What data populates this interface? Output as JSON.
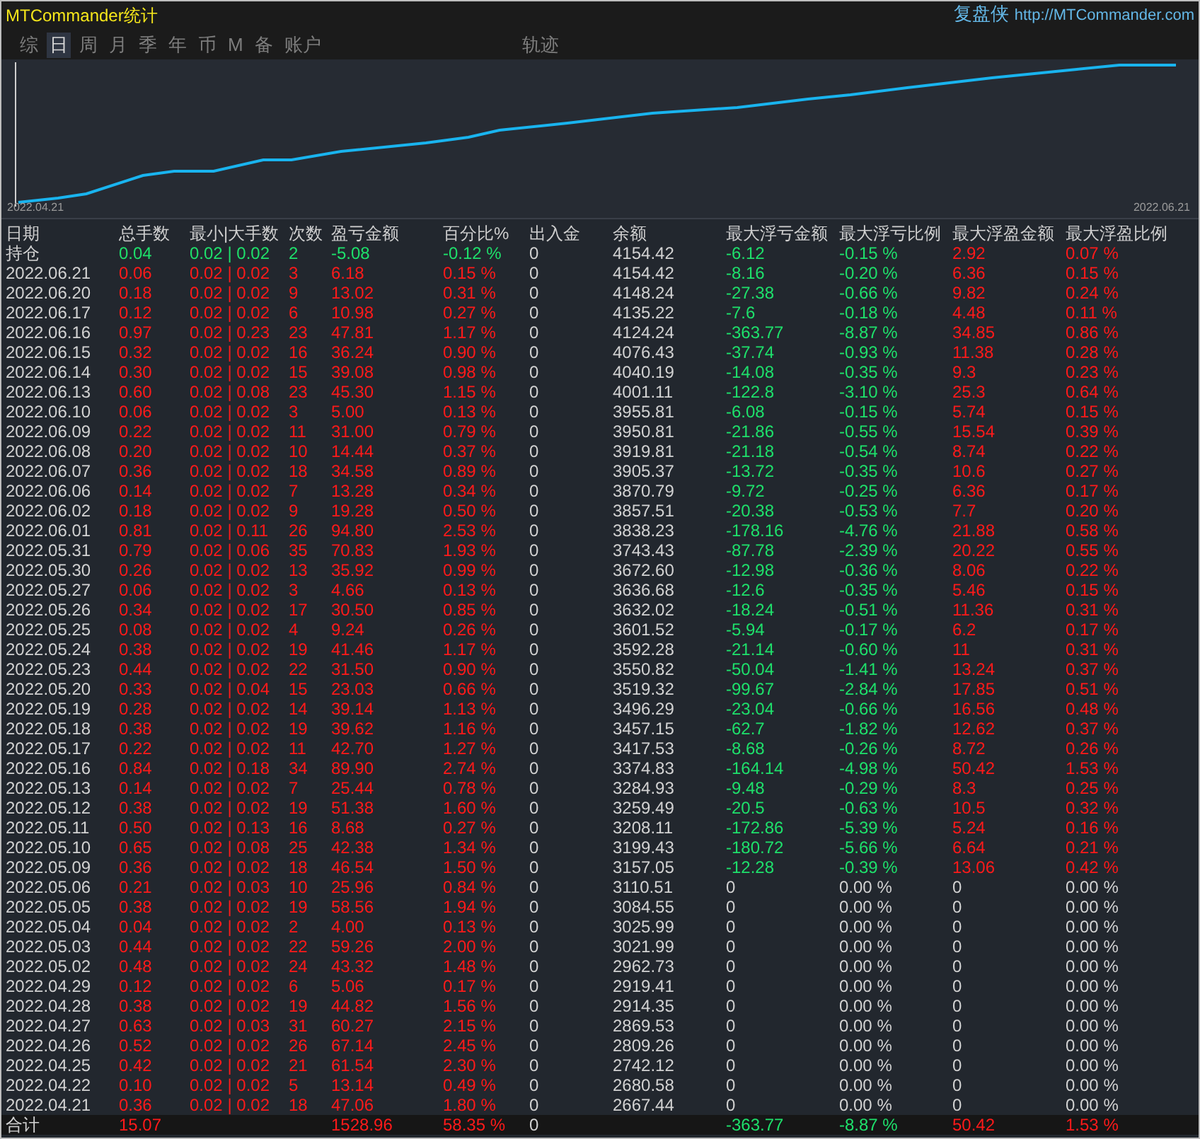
{
  "title": "MTCommander统计",
  "brand": {
    "name": "复盘侠",
    "url": "http://MTCommander.com"
  },
  "tabs": [
    {
      "label": "综",
      "selected": false
    },
    {
      "label": "日",
      "selected": true
    },
    {
      "label": "周",
      "selected": false
    },
    {
      "label": "月",
      "selected": false
    },
    {
      "label": "季",
      "selected": false
    },
    {
      "label": "年",
      "selected": false
    },
    {
      "label": "币",
      "selected": false
    },
    {
      "label": "M",
      "selected": false
    },
    {
      "label": "备",
      "selected": false
    },
    {
      "label": "账户",
      "selected": false
    },
    {
      "label": "轨迹",
      "selected": false
    }
  ],
  "chart": {
    "x_start": "2022.04.21",
    "x_end": "2022.06.21"
  },
  "table": {
    "columns": [
      "日期",
      "总手数",
      "最小|大手数",
      "次数",
      "盈亏金额",
      "百分比%",
      "出入金",
      "余额",
      "最大浮亏金额",
      "最大浮亏比例",
      "最大浮盈金额",
      "最大浮盈比例"
    ],
    "rows": [
      {
        "kind": "position",
        "profit": false,
        "float_recorded": true,
        "cells": [
          "持仓",
          "0.04",
          "0.02 | 0.02",
          "2",
          "-5.08",
          "-0.12 %",
          "0",
          "4154.42",
          "-6.12",
          "-0.15 %",
          "2.92",
          "0.07 %"
        ]
      },
      {
        "kind": "day",
        "profit": true,
        "float_recorded": true,
        "cells": [
          "2022.06.21",
          "0.06",
          "0.02 | 0.02",
          "3",
          "6.18",
          "0.15 %",
          "0",
          "4154.42",
          "-8.16",
          "-0.20 %",
          "6.36",
          "0.15 %"
        ]
      },
      {
        "kind": "day",
        "profit": true,
        "float_recorded": true,
        "cells": [
          "2022.06.20",
          "0.18",
          "0.02 | 0.02",
          "9",
          "13.02",
          "0.31 %",
          "0",
          "4148.24",
          "-27.38",
          "-0.66 %",
          "9.82",
          "0.24 %"
        ]
      },
      {
        "kind": "day",
        "profit": true,
        "float_recorded": true,
        "cells": [
          "2022.06.17",
          "0.12",
          "0.02 | 0.02",
          "6",
          "10.98",
          "0.27 %",
          "0",
          "4135.22",
          "-7.6",
          "-0.18 %",
          "4.48",
          "0.11 %"
        ]
      },
      {
        "kind": "day",
        "profit": true,
        "float_recorded": true,
        "cells": [
          "2022.06.16",
          "0.97",
          "0.02 | 0.23",
          "23",
          "47.81",
          "1.17 %",
          "0",
          "4124.24",
          "-363.77",
          "-8.87 %",
          "34.85",
          "0.86 %"
        ]
      },
      {
        "kind": "day",
        "profit": true,
        "float_recorded": true,
        "cells": [
          "2022.06.15",
          "0.32",
          "0.02 | 0.02",
          "16",
          "36.24",
          "0.90 %",
          "0",
          "4076.43",
          "-37.74",
          "-0.93 %",
          "11.38",
          "0.28 %"
        ]
      },
      {
        "kind": "day",
        "profit": true,
        "float_recorded": true,
        "cells": [
          "2022.06.14",
          "0.30",
          "0.02 | 0.02",
          "15",
          "39.08",
          "0.98 %",
          "0",
          "4040.19",
          "-14.08",
          "-0.35 %",
          "9.3",
          "0.23 %"
        ]
      },
      {
        "kind": "day",
        "profit": true,
        "float_recorded": true,
        "cells": [
          "2022.06.13",
          "0.60",
          "0.02 | 0.08",
          "23",
          "45.30",
          "1.15 %",
          "0",
          "4001.11",
          "-122.8",
          "-3.10 %",
          "25.3",
          "0.64 %"
        ]
      },
      {
        "kind": "day",
        "profit": true,
        "float_recorded": true,
        "cells": [
          "2022.06.10",
          "0.06",
          "0.02 | 0.02",
          "3",
          "5.00",
          "0.13 %",
          "0",
          "3955.81",
          "-6.08",
          "-0.15 %",
          "5.74",
          "0.15 %"
        ]
      },
      {
        "kind": "day",
        "profit": true,
        "float_recorded": true,
        "cells": [
          "2022.06.09",
          "0.22",
          "0.02 | 0.02",
          "11",
          "31.00",
          "0.79 %",
          "0",
          "3950.81",
          "-21.86",
          "-0.55 %",
          "15.54",
          "0.39 %"
        ]
      },
      {
        "kind": "day",
        "profit": true,
        "float_recorded": true,
        "cells": [
          "2022.06.08",
          "0.20",
          "0.02 | 0.02",
          "10",
          "14.44",
          "0.37 %",
          "0",
          "3919.81",
          "-21.18",
          "-0.54 %",
          "8.74",
          "0.22 %"
        ]
      },
      {
        "kind": "day",
        "profit": true,
        "float_recorded": true,
        "cells": [
          "2022.06.07",
          "0.36",
          "0.02 | 0.02",
          "18",
          "34.58",
          "0.89 %",
          "0",
          "3905.37",
          "-13.72",
          "-0.35 %",
          "10.6",
          "0.27 %"
        ]
      },
      {
        "kind": "day",
        "profit": true,
        "float_recorded": true,
        "cells": [
          "2022.06.06",
          "0.14",
          "0.02 | 0.02",
          "7",
          "13.28",
          "0.34 %",
          "0",
          "3870.79",
          "-9.72",
          "-0.25 %",
          "6.36",
          "0.17 %"
        ]
      },
      {
        "kind": "day",
        "profit": true,
        "float_recorded": true,
        "cells": [
          "2022.06.02",
          "0.18",
          "0.02 | 0.02",
          "9",
          "19.28",
          "0.50 %",
          "0",
          "3857.51",
          "-20.38",
          "-0.53 %",
          "7.7",
          "0.20 %"
        ]
      },
      {
        "kind": "day",
        "profit": true,
        "float_recorded": true,
        "cells": [
          "2022.06.01",
          "0.81",
          "0.02 | 0.11",
          "26",
          "94.80",
          "2.53 %",
          "0",
          "3838.23",
          "-178.16",
          "-4.76 %",
          "21.88",
          "0.58 %"
        ]
      },
      {
        "kind": "day",
        "profit": true,
        "float_recorded": true,
        "cells": [
          "2022.05.31",
          "0.79",
          "0.02 | 0.06",
          "35",
          "70.83",
          "1.93 %",
          "0",
          "3743.43",
          "-87.78",
          "-2.39 %",
          "20.22",
          "0.55 %"
        ]
      },
      {
        "kind": "day",
        "profit": true,
        "float_recorded": true,
        "cells": [
          "2022.05.30",
          "0.26",
          "0.02 | 0.02",
          "13",
          "35.92",
          "0.99 %",
          "0",
          "3672.60",
          "-12.98",
          "-0.36 %",
          "8.06",
          "0.22 %"
        ]
      },
      {
        "kind": "day",
        "profit": true,
        "float_recorded": true,
        "cells": [
          "2022.05.27",
          "0.06",
          "0.02 | 0.02",
          "3",
          "4.66",
          "0.13 %",
          "0",
          "3636.68",
          "-12.6",
          "-0.35 %",
          "5.46",
          "0.15 %"
        ]
      },
      {
        "kind": "day",
        "profit": true,
        "float_recorded": true,
        "cells": [
          "2022.05.26",
          "0.34",
          "0.02 | 0.02",
          "17",
          "30.50",
          "0.85 %",
          "0",
          "3632.02",
          "-18.24",
          "-0.51 %",
          "11.36",
          "0.31 %"
        ]
      },
      {
        "kind": "day",
        "profit": true,
        "float_recorded": true,
        "cells": [
          "2022.05.25",
          "0.08",
          "0.02 | 0.02",
          "4",
          "9.24",
          "0.26 %",
          "0",
          "3601.52",
          "-5.94",
          "-0.17 %",
          "6.2",
          "0.17 %"
        ]
      },
      {
        "kind": "day",
        "profit": true,
        "float_recorded": true,
        "cells": [
          "2022.05.24",
          "0.38",
          "0.02 | 0.02",
          "19",
          "41.46",
          "1.17 %",
          "0",
          "3592.28",
          "-21.14",
          "-0.60 %",
          "11",
          "0.31 %"
        ]
      },
      {
        "kind": "day",
        "profit": true,
        "float_recorded": true,
        "cells": [
          "2022.05.23",
          "0.44",
          "0.02 | 0.02",
          "22",
          "31.50",
          "0.90 %",
          "0",
          "3550.82",
          "-50.04",
          "-1.41 %",
          "13.24",
          "0.37 %"
        ]
      },
      {
        "kind": "day",
        "profit": true,
        "float_recorded": true,
        "cells": [
          "2022.05.20",
          "0.33",
          "0.02 | 0.04",
          "15",
          "23.03",
          "0.66 %",
          "0",
          "3519.32",
          "-99.67",
          "-2.84 %",
          "17.85",
          "0.51 %"
        ]
      },
      {
        "kind": "day",
        "profit": true,
        "float_recorded": true,
        "cells": [
          "2022.05.19",
          "0.28",
          "0.02 | 0.02",
          "14",
          "39.14",
          "1.13 %",
          "0",
          "3496.29",
          "-23.04",
          "-0.66 %",
          "16.56",
          "0.48 %"
        ]
      },
      {
        "kind": "day",
        "profit": true,
        "float_recorded": true,
        "cells": [
          "2022.05.18",
          "0.38",
          "0.02 | 0.02",
          "19",
          "39.62",
          "1.16 %",
          "0",
          "3457.15",
          "-62.7",
          "-1.82 %",
          "12.62",
          "0.37 %"
        ]
      },
      {
        "kind": "day",
        "profit": true,
        "float_recorded": true,
        "cells": [
          "2022.05.17",
          "0.22",
          "0.02 | 0.02",
          "11",
          "42.70",
          "1.27 %",
          "0",
          "3417.53",
          "-8.68",
          "-0.26 %",
          "8.72",
          "0.26 %"
        ]
      },
      {
        "kind": "day",
        "profit": true,
        "float_recorded": true,
        "cells": [
          "2022.05.16",
          "0.84",
          "0.02 | 0.18",
          "34",
          "89.90",
          "2.74 %",
          "0",
          "3374.83",
          "-164.14",
          "-4.98 %",
          "50.42",
          "1.53 %"
        ]
      },
      {
        "kind": "day",
        "profit": true,
        "float_recorded": true,
        "cells": [
          "2022.05.13",
          "0.14",
          "0.02 | 0.02",
          "7",
          "25.44",
          "0.78 %",
          "0",
          "3284.93",
          "-9.48",
          "-0.29 %",
          "8.3",
          "0.25 %"
        ]
      },
      {
        "kind": "day",
        "profit": true,
        "float_recorded": true,
        "cells": [
          "2022.05.12",
          "0.38",
          "0.02 | 0.02",
          "19",
          "51.38",
          "1.60 %",
          "0",
          "3259.49",
          "-20.5",
          "-0.63 %",
          "10.5",
          "0.32 %"
        ]
      },
      {
        "kind": "day",
        "profit": true,
        "float_recorded": true,
        "cells": [
          "2022.05.11",
          "0.50",
          "0.02 | 0.13",
          "16",
          "8.68",
          "0.27 %",
          "0",
          "3208.11",
          "-172.86",
          "-5.39 %",
          "5.24",
          "0.16 %"
        ]
      },
      {
        "kind": "day",
        "profit": true,
        "float_recorded": true,
        "cells": [
          "2022.05.10",
          "0.65",
          "0.02 | 0.08",
          "25",
          "42.38",
          "1.34 %",
          "0",
          "3199.43",
          "-180.72",
          "-5.66 %",
          "6.64",
          "0.21 %"
        ]
      },
      {
        "kind": "day",
        "profit": true,
        "float_recorded": true,
        "cells": [
          "2022.05.09",
          "0.36",
          "0.02 | 0.02",
          "18",
          "46.54",
          "1.50 %",
          "0",
          "3157.05",
          "-12.28",
          "-0.39 %",
          "13.06",
          "0.42 %"
        ]
      },
      {
        "kind": "day",
        "profit": true,
        "float_recorded": false,
        "cells": [
          "2022.05.06",
          "0.21",
          "0.02 | 0.03",
          "10",
          "25.96",
          "0.84 %",
          "0",
          "3110.51",
          "0",
          "0.00 %",
          "0",
          "0.00 %"
        ]
      },
      {
        "kind": "day",
        "profit": true,
        "float_recorded": false,
        "cells": [
          "2022.05.05",
          "0.38",
          "0.02 | 0.02",
          "19",
          "58.56",
          "1.94 %",
          "0",
          "3084.55",
          "0",
          "0.00 %",
          "0",
          "0.00 %"
        ]
      },
      {
        "kind": "day",
        "profit": true,
        "float_recorded": false,
        "cells": [
          "2022.05.04",
          "0.04",
          "0.02 | 0.02",
          "2",
          "4.00",
          "0.13 %",
          "0",
          "3025.99",
          "0",
          "0.00 %",
          "0",
          "0.00 %"
        ]
      },
      {
        "kind": "day",
        "profit": true,
        "float_recorded": false,
        "cells": [
          "2022.05.03",
          "0.44",
          "0.02 | 0.02",
          "22",
          "59.26",
          "2.00 %",
          "0",
          "3021.99",
          "0",
          "0.00 %",
          "0",
          "0.00 %"
        ]
      },
      {
        "kind": "day",
        "profit": true,
        "float_recorded": false,
        "cells": [
          "2022.05.02",
          "0.48",
          "0.02 | 0.02",
          "24",
          "43.32",
          "1.48 %",
          "0",
          "2962.73",
          "0",
          "0.00 %",
          "0",
          "0.00 %"
        ]
      },
      {
        "kind": "day",
        "profit": true,
        "float_recorded": false,
        "cells": [
          "2022.04.29",
          "0.12",
          "0.02 | 0.02",
          "6",
          "5.06",
          "0.17 %",
          "0",
          "2919.41",
          "0",
          "0.00 %",
          "0",
          "0.00 %"
        ]
      },
      {
        "kind": "day",
        "profit": true,
        "float_recorded": false,
        "cells": [
          "2022.04.28",
          "0.38",
          "0.02 | 0.02",
          "19",
          "44.82",
          "1.56 %",
          "0",
          "2914.35",
          "0",
          "0.00 %",
          "0",
          "0.00 %"
        ]
      },
      {
        "kind": "day",
        "profit": true,
        "float_recorded": false,
        "cells": [
          "2022.04.27",
          "0.63",
          "0.02 | 0.03",
          "31",
          "60.27",
          "2.15 %",
          "0",
          "2869.53",
          "0",
          "0.00 %",
          "0",
          "0.00 %"
        ]
      },
      {
        "kind": "day",
        "profit": true,
        "float_recorded": false,
        "cells": [
          "2022.04.26",
          "0.52",
          "0.02 | 0.02",
          "26",
          "67.14",
          "2.45 %",
          "0",
          "2809.26",
          "0",
          "0.00 %",
          "0",
          "0.00 %"
        ]
      },
      {
        "kind": "day",
        "profit": true,
        "float_recorded": false,
        "cells": [
          "2022.04.25",
          "0.42",
          "0.02 | 0.02",
          "21",
          "61.54",
          "2.30 %",
          "0",
          "2742.12",
          "0",
          "0.00 %",
          "0",
          "0.00 %"
        ]
      },
      {
        "kind": "day",
        "profit": true,
        "float_recorded": false,
        "cells": [
          "2022.04.22",
          "0.10",
          "0.02 | 0.02",
          "5",
          "13.14",
          "0.49 %",
          "0",
          "2680.58",
          "0",
          "0.00 %",
          "0",
          "0.00 %"
        ]
      },
      {
        "kind": "day",
        "profit": true,
        "float_recorded": false,
        "cells": [
          "2022.04.21",
          "0.36",
          "0.02 | 0.02",
          "18",
          "47.06",
          "1.80 %",
          "0",
          "2667.44",
          "0",
          "0.00 %",
          "0",
          "0.00 %"
        ]
      },
      {
        "kind": "total",
        "profit": true,
        "float_recorded": true,
        "cells": [
          "合计",
          "15.07",
          null,
          null,
          "1528.96",
          "58.35 %",
          "0",
          null,
          "-363.77",
          "-8.87 %",
          "50.42",
          "1.53 %"
        ]
      }
    ]
  }
}
